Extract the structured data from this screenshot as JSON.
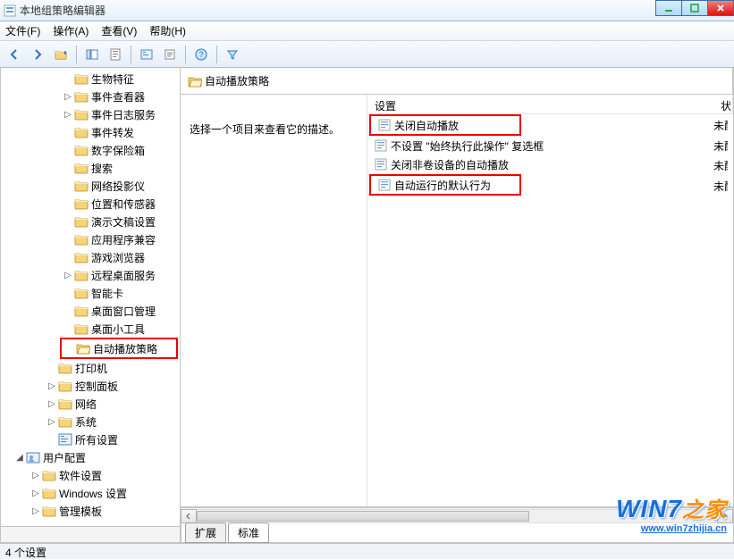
{
  "window": {
    "title": "本地组策略编辑器"
  },
  "menus": [
    "文件(F)",
    "操作(A)",
    "查看(V)",
    "帮助(H)"
  ],
  "toolbar_icons": [
    "back",
    "forward",
    "up",
    "show-hide-tree",
    "properties",
    "refresh",
    "export",
    "help",
    "filter"
  ],
  "tree": [
    {
      "indent": 3,
      "tw": "",
      "icon": "folder",
      "label": "生物特征"
    },
    {
      "indent": 3,
      "tw": "▷",
      "icon": "folder",
      "label": "事件查看器"
    },
    {
      "indent": 3,
      "tw": "▷",
      "icon": "folder",
      "label": "事件日志服务"
    },
    {
      "indent": 3,
      "tw": "",
      "icon": "folder",
      "label": "事件转发"
    },
    {
      "indent": 3,
      "tw": "",
      "icon": "folder",
      "label": "数字保险箱"
    },
    {
      "indent": 3,
      "tw": "",
      "icon": "folder",
      "label": "搜索"
    },
    {
      "indent": 3,
      "tw": "",
      "icon": "folder",
      "label": "网络投影仪"
    },
    {
      "indent": 3,
      "tw": "",
      "icon": "folder",
      "label": "位置和传感器"
    },
    {
      "indent": 3,
      "tw": "",
      "icon": "folder",
      "label": "演示文稿设置"
    },
    {
      "indent": 3,
      "tw": "",
      "icon": "folder",
      "label": "应用程序兼容"
    },
    {
      "indent": 3,
      "tw": "",
      "icon": "folder",
      "label": "游戏浏览器"
    },
    {
      "indent": 3,
      "tw": "▷",
      "icon": "folder",
      "label": "远程桌面服务"
    },
    {
      "indent": 3,
      "tw": "",
      "icon": "folder",
      "label": "智能卡"
    },
    {
      "indent": 3,
      "tw": "",
      "icon": "folder",
      "label": "桌面窗口管理"
    },
    {
      "indent": 3,
      "tw": "",
      "icon": "folder",
      "label": "桌面小工具"
    },
    {
      "indent": 3,
      "tw": "",
      "icon": "folder-open",
      "label": "自动播放策略",
      "redbox": true
    },
    {
      "indent": 2,
      "tw": "",
      "icon": "folder",
      "label": "打印机"
    },
    {
      "indent": 2,
      "tw": "▷",
      "icon": "folder",
      "label": "控制面板"
    },
    {
      "indent": 2,
      "tw": "▷",
      "icon": "folder",
      "label": "网络"
    },
    {
      "indent": 2,
      "tw": "▷",
      "icon": "folder",
      "label": "系统"
    },
    {
      "indent": 2,
      "tw": "",
      "icon": "settings",
      "label": "所有设置"
    },
    {
      "indent": 0,
      "tw": "◢",
      "icon": "user-cfg",
      "label": "用户配置"
    },
    {
      "indent": 1,
      "tw": "▷",
      "icon": "folder",
      "label": "软件设置"
    },
    {
      "indent": 1,
      "tw": "▷",
      "icon": "folder",
      "label": "Windows 设置"
    },
    {
      "indent": 1,
      "tw": "▷",
      "icon": "folder",
      "label": "管理模板"
    }
  ],
  "right": {
    "header": "自动播放策略",
    "desc": "选择一个项目来查看它的描述。",
    "col_settings": "设置",
    "col_state": "状",
    "items": [
      {
        "label": "关闭自动播放",
        "state": "未配",
        "redbox": true
      },
      {
        "label": "不设置 \"始终执行此操作\" 复选框",
        "state": "未配"
      },
      {
        "label": "关闭非卷设备的自动播放",
        "state": "未配"
      },
      {
        "label": "自动运行的默认行为",
        "state": "未配",
        "redbox": true
      }
    ]
  },
  "tabs": {
    "extended": "扩展",
    "standard": "标准"
  },
  "status": "4 个设置",
  "watermark": {
    "brand": "WIN7",
    "cn": "之家",
    "url": "www.win7zhijia.cn"
  }
}
